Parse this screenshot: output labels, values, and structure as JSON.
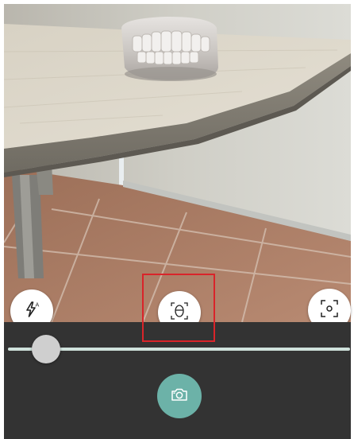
{
  "icons": {
    "flash": "flash-auto-icon",
    "face": "face-detection-icon",
    "focus": "focus-target-icon",
    "shutter": "camera-icon"
  },
  "slider": {
    "zoom_fraction": 0.07
  },
  "colors": {
    "controls_background": "#333333",
    "shutter": "#6cb2a8",
    "slider_track": "#cfe2dc",
    "highlight": "#d9242a"
  }
}
